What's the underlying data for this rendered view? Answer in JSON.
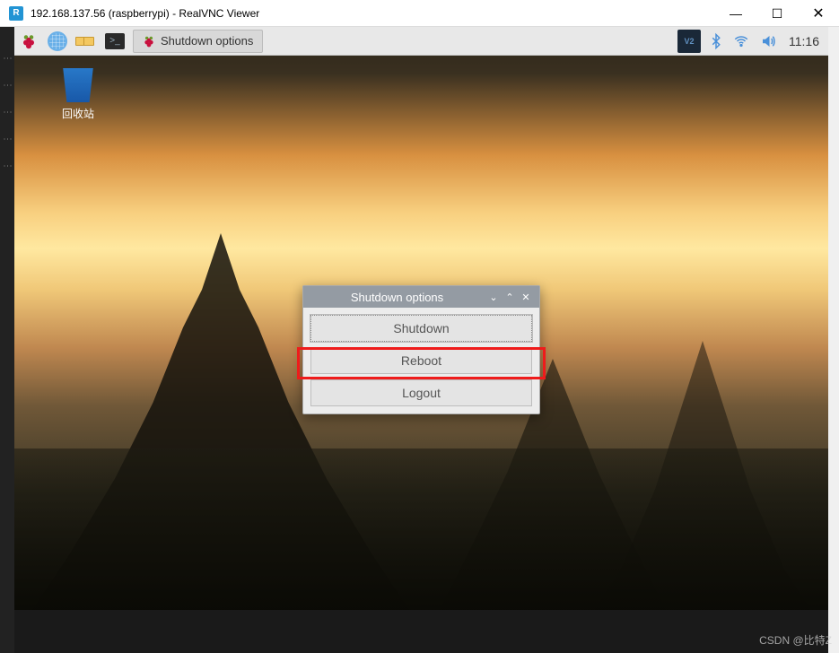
{
  "window": {
    "title": "192.168.137.56 (raspberrypi) - RealVNC Viewer",
    "icon_letter": "R"
  },
  "panel": {
    "taskbar_item": "Shutdown options",
    "clock": "11:16",
    "vnc_badge": "V2"
  },
  "desktop": {
    "trash_label": "回收站"
  },
  "dialog": {
    "title": "Shutdown options",
    "buttons": {
      "shutdown": "Shutdown",
      "reboot": "Reboot",
      "logout": "Logout"
    }
  },
  "watermark": "CSDN @比特Z"
}
